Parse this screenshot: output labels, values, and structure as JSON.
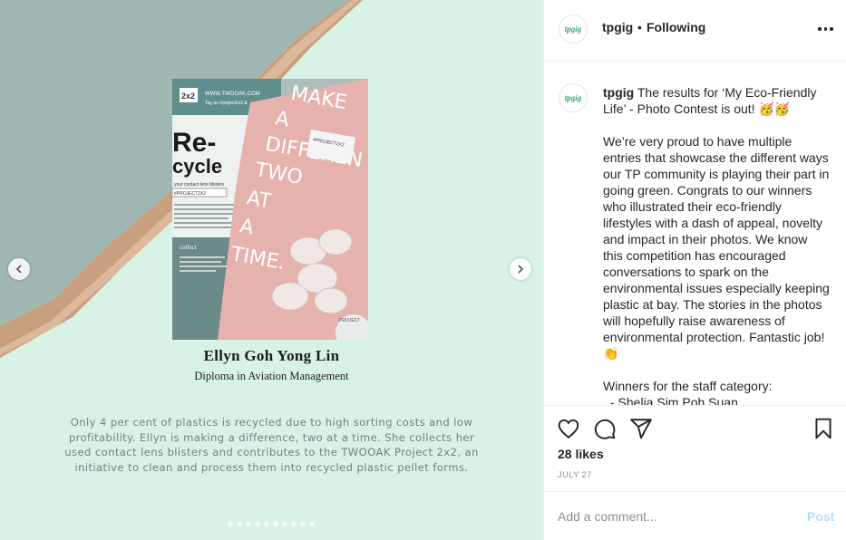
{
  "media": {
    "winner_name": "Ellyn Goh Yong Lin",
    "winner_diploma": "Diploma in Aviation Management",
    "caption_lines": [
      "Only 4 per cent of plastics is recycled due to high sorting costs and low",
      "profitability. Ellyn is making a difference, two at a time. She collects her",
      "used contact lens blisters and contributes to the TWOOAK Project 2x2, an",
      "initiative to clean and process them into recycled plastic pellet forms."
    ],
    "photo_text": {
      "badge": "2x2",
      "url": "WWW.TWOOAK.COM",
      "tag": "Tag us #project2x2 &",
      "re": "Re-",
      "cycle": "cycle",
      "blurb": "your contact lens blisters",
      "hashtag": "#PROJECT2X2",
      "collect": "collect",
      "pink_lines": [
        "MAKE",
        "A",
        "DIFFEREN",
        "TWO",
        "AT",
        "A",
        "TIME."
      ],
      "sticker": "#PROJECT2X2",
      "project": "PROJECT"
    },
    "dots_total": 10,
    "dots_active_index": 5
  },
  "header": {
    "avatar_text": "tpgig",
    "username": "tpgig",
    "separator": "•",
    "follow_status": "Following"
  },
  "post": {
    "username": "tpgig",
    "first_line": " The results for ‘My Eco-Friendly Life’ - Photo Contest is out! 🥳🥳",
    "paragraph": "We’re very proud to have multiple entries that showcase the different ways our TP community is playing their part in going green. Congrats to our winners who illustrated their eco-friendly lifestyles with a dash of appeal, novelty and impact in their photos. We know this competition has encouraged conversations to spark on the environmental issues especially keeping plastic at bay. The stories in the photos will hopefully raise awareness of environmental protection. Fantastic job! 👏",
    "winners_label": "Winners for the staff category:",
    "winner_1": "- Shelia Sim Poh Suan"
  },
  "actions": {
    "likes": "28 likes",
    "date": "JULY 27"
  },
  "comment_box": {
    "placeholder": "Add a comment...",
    "post_label": "Post"
  },
  "colors": {
    "mint": "#d9f2e6",
    "slate": "#9cb4b0",
    "copper": "#c99b7a",
    "pink_book": "#e8b4b0",
    "link_disabled": "#b2dffc"
  }
}
